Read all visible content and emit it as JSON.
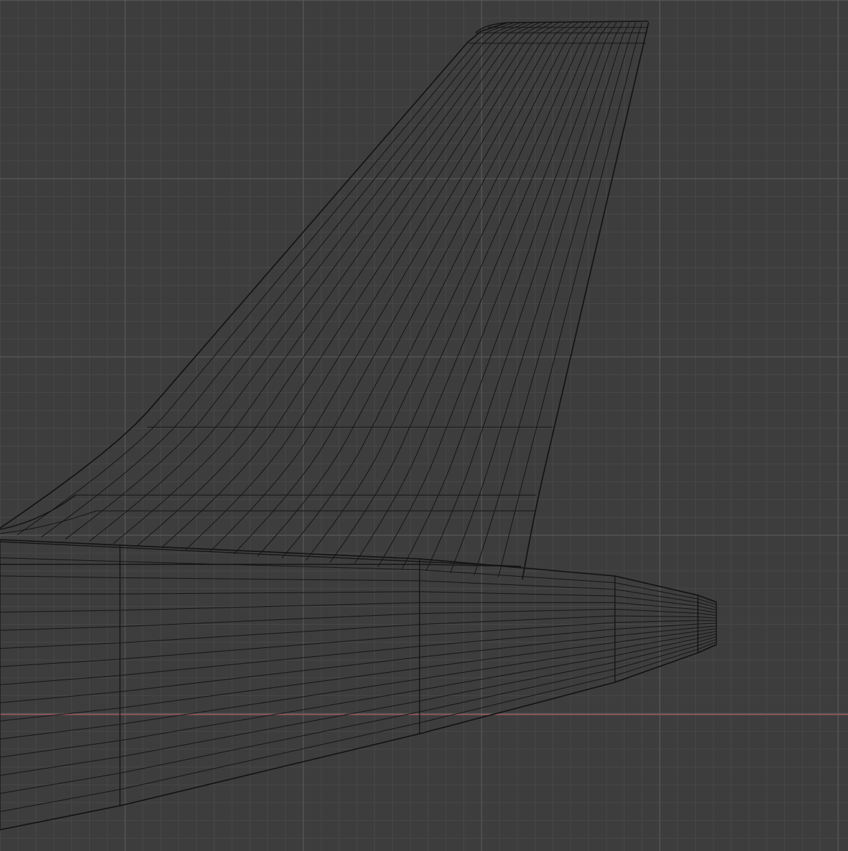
{
  "viewport": {
    "view": "orthographic-side",
    "shading": "wireframe",
    "background_color": "#3d3d3d",
    "minor_grid_color": "#474747",
    "major_grid_color": "#555555",
    "x_axis_color": "#b25a64",
    "wire_color": "#141414",
    "objects": [
      "vertical-stabilizer",
      "fuselage-tail-cone"
    ]
  }
}
